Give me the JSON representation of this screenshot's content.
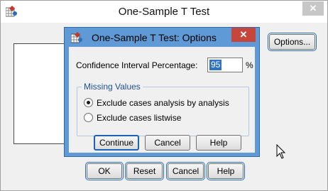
{
  "main_window": {
    "title": "One-Sample T Test",
    "close_glyph": "✕",
    "buttons": {
      "options": "Options...",
      "ok": "OK",
      "reset": "Reset",
      "cancel": "Cancel",
      "help": "Help"
    }
  },
  "options_dialog": {
    "title": "One-Sample T Test: Options",
    "close_glyph": "✕",
    "ci_label": "Confidence Interval Percentage:",
    "ci_value": "95",
    "ci_unit": "%",
    "missing_values": {
      "legend": "Missing Values",
      "options": [
        {
          "label": "Exclude cases analysis by analysis",
          "selected": true
        },
        {
          "label": "Exclude cases listwise",
          "selected": false
        }
      ]
    },
    "buttons": {
      "continue": "Continue",
      "cancel": "Cancel",
      "help": "Help"
    }
  },
  "colors": {
    "dialog_frame": "#5f9ad6",
    "close_button": "#c6463c",
    "selection_highlight": "#3072c4"
  },
  "icons": {
    "app_icon": "spss-app-icon",
    "cursor": "mouse-pointer-icon"
  }
}
